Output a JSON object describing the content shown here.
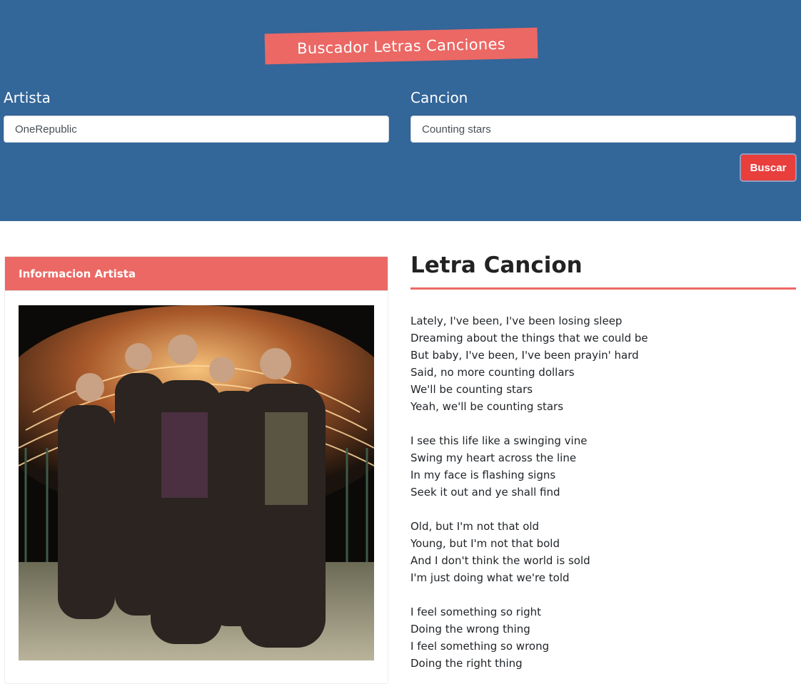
{
  "header": {
    "title": "Buscador Letras Canciones",
    "artist_label": "Artista",
    "artist_value": "OneRepublic",
    "song_label": "Cancion",
    "song_value": "Counting stars",
    "search_button": "Buscar"
  },
  "artist_card": {
    "header": "Informacion Artista",
    "photo": "band-photo"
  },
  "lyrics": {
    "title": "Letra Cancion",
    "stanzas": [
      [
        "Lately, I've been, I've been losing sleep",
        "Dreaming about the things that we could be",
        "But baby, I've been, I've been prayin' hard",
        "Said, no more counting dollars",
        "We'll be counting stars",
        "Yeah, we'll be counting stars"
      ],
      [
        "I see this life like a swinging vine",
        "Swing my heart across the line",
        "In my face is flashing signs",
        "Seek it out and ye shall find"
      ],
      [
        "Old, but I'm not that old",
        "Young, but I'm not that bold",
        "And I don't think the world is sold",
        "I'm just doing what we're told"
      ],
      [
        "I feel something so right",
        "Doing the wrong thing",
        "I feel something so wrong",
        "Doing the right thing"
      ]
    ]
  },
  "colors": {
    "header_bg": "#336699",
    "accent": "#eb6864",
    "button": "#e83e3c"
  }
}
